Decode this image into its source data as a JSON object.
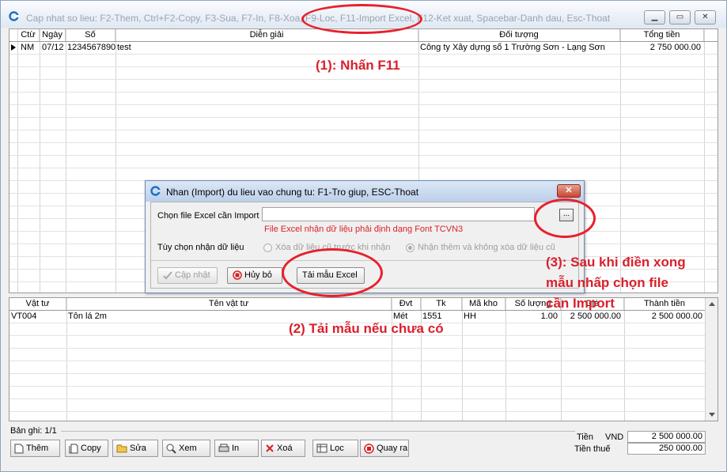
{
  "window": {
    "title": "Cap nhat so lieu: F2-Them, Ctrl+F2-Copy, F3-Sua, F7-In, F8-Xoa, F9-Loc, F11-Import Excel, F12-Ket xuat, Spacebar-Danh dau, Esc-Thoat",
    "minimize": "▁",
    "maximize": "▭",
    "close": "✕"
  },
  "master": {
    "columns": [
      "Ctừ",
      "Ngày",
      "Số",
      "Diễn giải",
      "Đối tượng",
      "Tổng tiền"
    ],
    "row": {
      "ctu": "NM",
      "ngay": "07/12",
      "so": "1234567890",
      "dien_giai": "test",
      "doi_tuong": "Công ty Xây dựng số 1 Trường Sơn - Lạng Sơn",
      "tong_tien": "2 750 000.00"
    }
  },
  "detail": {
    "columns": [
      "Vật tư",
      "Tên vật tư",
      "Đvt",
      "Tk",
      "Mã kho",
      "Số lượng",
      "Giá",
      "Thành tiền"
    ],
    "row": {
      "vat_tu": "VT004",
      "ten": "Tôn lá 2m",
      "dvt": "Mét",
      "tk": "1551",
      "ma_kho": "HH",
      "so_luong": "1.00",
      "gia": "2 500 000.00",
      "thanh_tien": "2 500 000.00"
    }
  },
  "dialog": {
    "title": "Nhan (Import) du lieu vao chung tu: F1-Tro giup, ESC-Thoat",
    "close": "✕",
    "file_label": "Chọn file Excel cần Import",
    "file_value": "",
    "browse_label": "...",
    "note": "File Excel nhận dữ liệu phải định dạng Font TCVN3",
    "option_label": "Tùy chọn nhận dữ liệu",
    "option1": "Xóa dữ liệu cũ trước khi nhận",
    "option2": "Nhận thêm và không xóa dữ liệu cũ",
    "btn_update": "Cập nhật",
    "btn_cancel": "Hủy bỏ",
    "btn_template": "Tải mẫu Excel"
  },
  "annotations": {
    "a1": "(1): Nhấn F11",
    "a2": "(2) Tải mẫu nếu chưa có",
    "a3_l1": "(3): Sau khi điền xong",
    "a3_l2": "mẫu nhấp chọn file",
    "a3_l3": "cần Import"
  },
  "footer": {
    "records": "Bản ghi: 1/1",
    "buttons": [
      "Thêm",
      "Copy",
      "Sửa",
      "Xem",
      "In",
      "Xoá",
      "Lọc",
      "Quay ra"
    ],
    "tien_label": "Tiền",
    "currency": "VND",
    "tien_value": "2 500 000.00",
    "thue_label": "Tiền thuế",
    "thue_value": "250 000.00"
  },
  "colors": {
    "accent_red": "#d9202c",
    "title_gray": "#9aa4b0"
  }
}
